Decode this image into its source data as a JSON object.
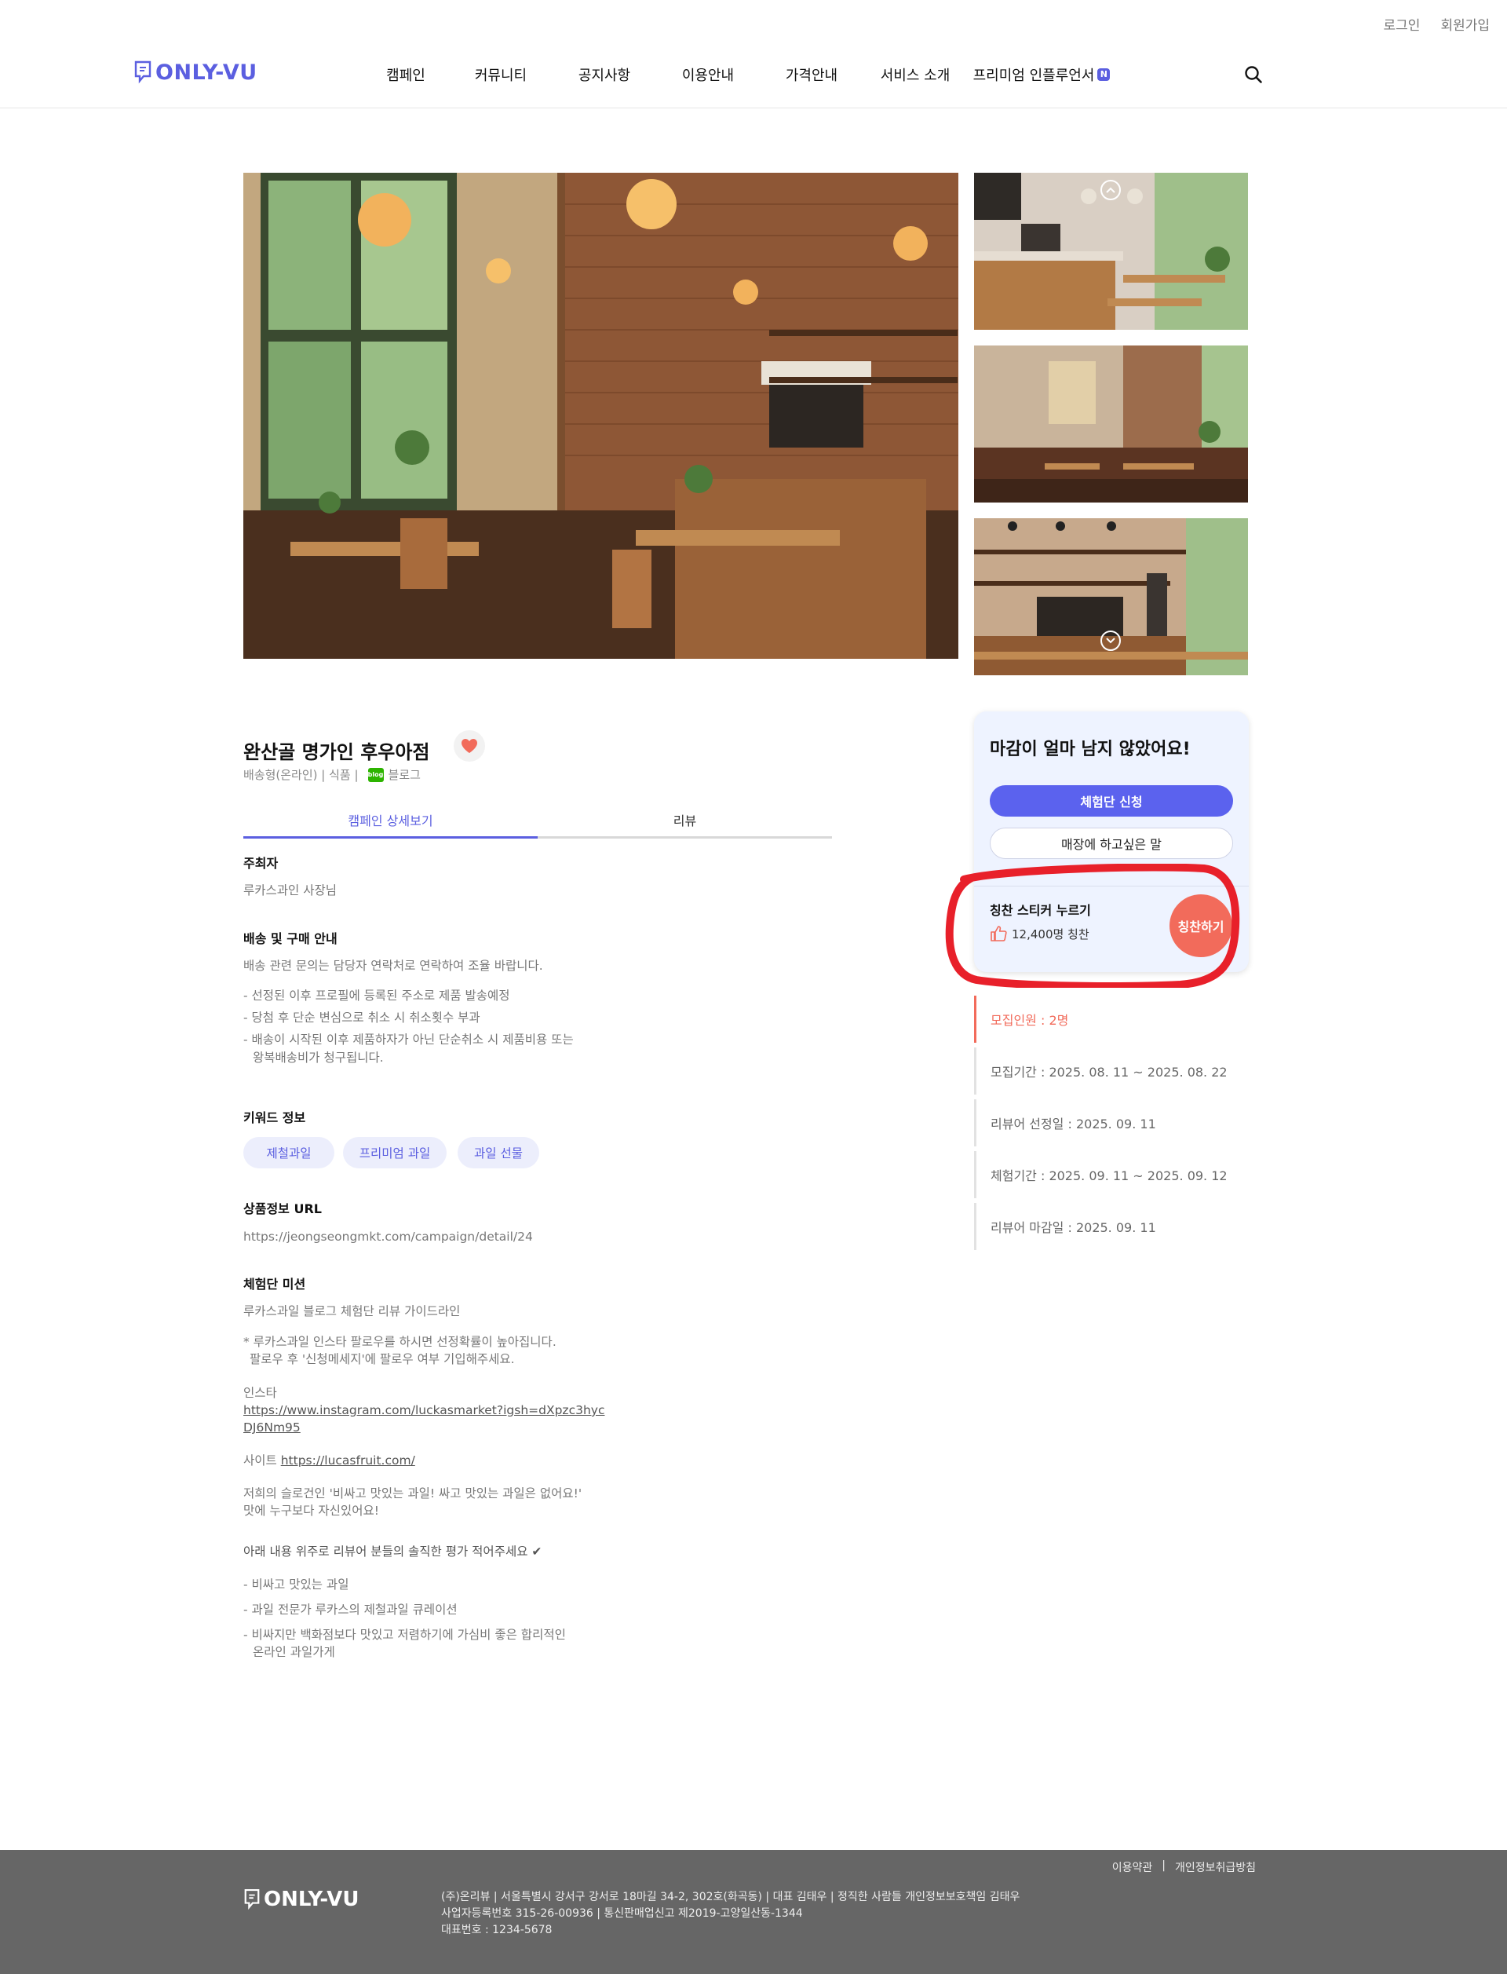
{
  "header": {
    "login": "로그인",
    "signup": "회원가입",
    "logo": "ONLY-VU",
    "nav": [
      "캠페인",
      "커뮤니티",
      "공지사항",
      "이용안내",
      "가격안내",
      "서비스 소개",
      "프리미엄 인플루언서"
    ],
    "new_badge": "N"
  },
  "campaign": {
    "title": "완산골 명가인 후우아점",
    "meta_type": "배송형(온라인) | 식품 |",
    "meta_channel": "블로그",
    "blog_icon_text": "blog",
    "tabs": [
      "캠페인 상세보기",
      "리뷰"
    ]
  },
  "detail": {
    "host_h": "주최자",
    "host": "루카스과인 사장님",
    "shipping_h": "배송 및 구매 안내",
    "shipping_intro": "배송 관련 문의는 담당자 연락처로 연락하여 조율 바랍니다.",
    "shipping_1": "- 선정된 이후 프로필에 등록된 주소로 제품 발송예정",
    "shipping_2": "- 당첨 후 단순 변심으로 취소 시 취소횟수 부과",
    "shipping_3a": "- 배송이 시작된 이후 제품하자가 아닌 단순취소 시 제품비용 또는",
    "shipping_3b": "왕복배송비가 청구됩니다.",
    "keyword_h": "키워드 정보",
    "keywords": [
      "제철과일",
      "프리미엄 과일",
      "과일 선물"
    ],
    "url_h": "상품정보 URL",
    "url": "https://jeongseongmkt.com/campaign/detail/24",
    "mission_h": "체험단 미션",
    "mission_1": "루카스과일 블로그 체험단 리뷰 가이드라인",
    "mission_2a": "* 루카스과일 인스타 팔로우를 하시면 선정확률이 높아집니다.",
    "mission_2b": "팔로우 후 '신청메세지'에 팔로우 여부 기입해주세요.",
    "insta_label": "인스타",
    "insta_url_a": "https://www.instagram.com/luckasmarket?igsh=dXpzc3hyc",
    "insta_url_b": "DJ6Nm95",
    "site_label": "사이트",
    "site_url": "https://lucasfruit.com/",
    "slogan_a": "저희의 슬로건인 '비싸고 맛있는 과일! 싸고 맛있는 과일은 없어요!'",
    "slogan_b": "맛에 누구보다 자신있어요!",
    "review_guide": "아래 내용 위주로 리뷰어 분들의 솔직한 평가 적어주세요 ✔",
    "point_1": "- 비싸고 맛있는 과일",
    "point_2": "- 과일 전문가 루카스의 제철과일 큐레이션",
    "point_3a": "- 비싸지만 백화점보다 맛있고 저렴하기에 가심비 좋은 합리적인",
    "point_3b": "온라인 과일가게"
  },
  "sidebar": {
    "card_title": "마감이 얼마 남지 않았어요!",
    "apply_btn": "체험단 신청",
    "message_btn": "매장에 하고싶은 말",
    "praise_h": "칭찬 스티커 누르기",
    "praise_count": "12,400명 칭찬",
    "praise_btn": "칭찬하기",
    "info": [
      "모집인원 :  2명",
      "모집기간 :  2025. 08. 11 ~ 2025. 08. 22",
      "리뷰어 선정일 :  2025. 09. 11",
      "체험기간 :  2025. 09. 11 ~ 2025. 09. 12",
      "리뷰어 마감일 :  2025. 09. 11"
    ]
  },
  "footer": {
    "terms": "이용약관",
    "privacy": "개인정보취급방침",
    "logo": "ONLY-VU",
    "line1": "(주)온리뷰  |  서울특별시 강서구 강서로 18마길 34-2, 302호(화곡동)  |  대표 김태우 | 정직한 사람들 개인정보보호책임 김태우",
    "line2": "사업자등록번호 315-26-00936  |  통신판매업신고 제2019-고양일산동-1344",
    "line3": "대표번호 : 1234-5678"
  },
  "colors": {
    "accent": "#5b5fe0",
    "praise": "#f26b5b",
    "annotation": "#e8202a",
    "footer_bg": "#666666"
  }
}
